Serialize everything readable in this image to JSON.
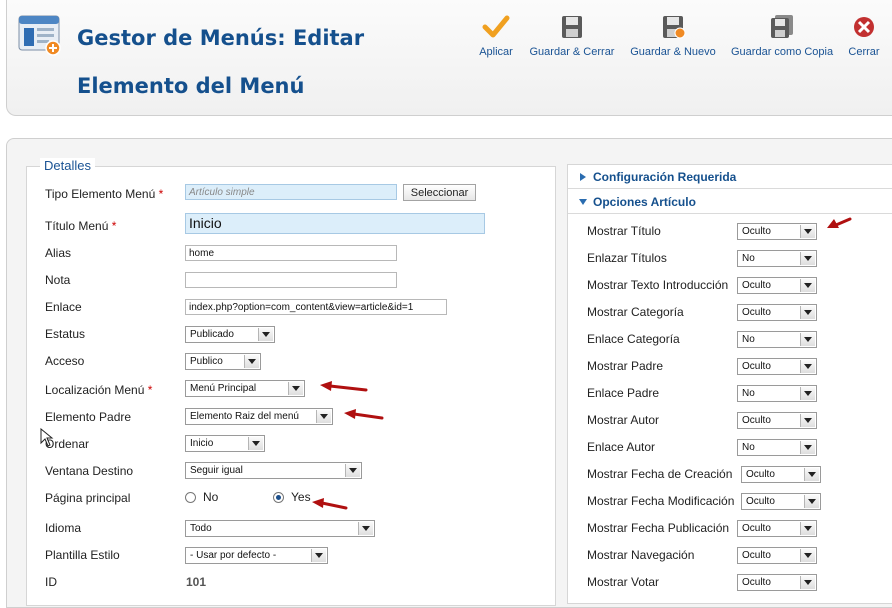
{
  "page_title": "Gestor de Menús: Editar Elemento del Menú",
  "toolbar": {
    "buttons": [
      {
        "label": "Aplicar",
        "icon": "checkmark-icon"
      },
      {
        "label": "Guardar & Cerrar",
        "icon": "save-icon"
      },
      {
        "label": "Guardar & Nuevo",
        "icon": "save-new-icon"
      },
      {
        "label": "Guardar como Copia",
        "icon": "save-copy-icon"
      },
      {
        "label": "Cerrar",
        "icon": "close-icon"
      }
    ]
  },
  "details": {
    "legend": "Detalles",
    "tipo_label": "Tipo Elemento Menú",
    "tipo_value": "Artículo simple",
    "tipo_button": "Seleccionar",
    "titulo_label": "Título Menú",
    "titulo_value": "Inicio",
    "alias_label": "Alias",
    "alias_value": "home",
    "nota_label": "Nota",
    "nota_value": "",
    "enlace_label": "Enlace",
    "enlace_value": "index.php?option=com_content&view=article&id=1",
    "estatus_label": "Estatus",
    "estatus_value": "Publicado",
    "acceso_label": "Acceso",
    "acceso_value": "Publico",
    "localizacion_label": "Localización Menú",
    "localizacion_value": "Menú Principal",
    "padre_label": "Elemento Padre",
    "padre_value": "Elemento Raiz del menú",
    "ordenar_label": "Ordenar",
    "ordenar_value": "Inicio",
    "ventana_label": "Ventana Destino",
    "ventana_value": "Seguir igual",
    "pagina_label": "Página principal",
    "pagina_no": "No",
    "pagina_yes": "Yes",
    "idioma_label": "Idioma",
    "idioma_value": "Todo",
    "plantilla_label": "Plantilla Estilo",
    "plantilla_value": "- Usar por defecto -",
    "id_label": "ID",
    "id_value": "101",
    "required_mark": "*"
  },
  "right": {
    "config_header": "Configuración Requerida",
    "options_header": "Opciones Artículo",
    "options": [
      {
        "label": "Mostrar Título",
        "value": "Oculto"
      },
      {
        "label": "Enlazar Títulos",
        "value": "No"
      },
      {
        "label": "Mostrar Texto Introducción",
        "value": "Oculto"
      },
      {
        "label": "Mostrar Categoría",
        "value": "Oculto"
      },
      {
        "label": "Enlace Categoría",
        "value": "No"
      },
      {
        "label": "Mostrar Padre",
        "value": "Oculto"
      },
      {
        "label": "Enlace Padre",
        "value": "No"
      },
      {
        "label": "Mostrar Autor",
        "value": "Oculto"
      },
      {
        "label": "Enlace Autor",
        "value": "No"
      },
      {
        "label": "Mostrar Fecha de Creación",
        "value": "Oculto"
      },
      {
        "label": "Mostrar Fecha Modificación",
        "value": "Oculto"
      },
      {
        "label": "Mostrar Fecha Publicación",
        "value": "Oculto"
      },
      {
        "label": "Mostrar Navegación",
        "value": "Oculto"
      },
      {
        "label": "Mostrar Votar",
        "value": "Oculto"
      }
    ]
  },
  "colors": {
    "title": "#15508d",
    "accent": "#1a5394",
    "required": "#cc0000",
    "annotation_arrow": "#b01010"
  }
}
